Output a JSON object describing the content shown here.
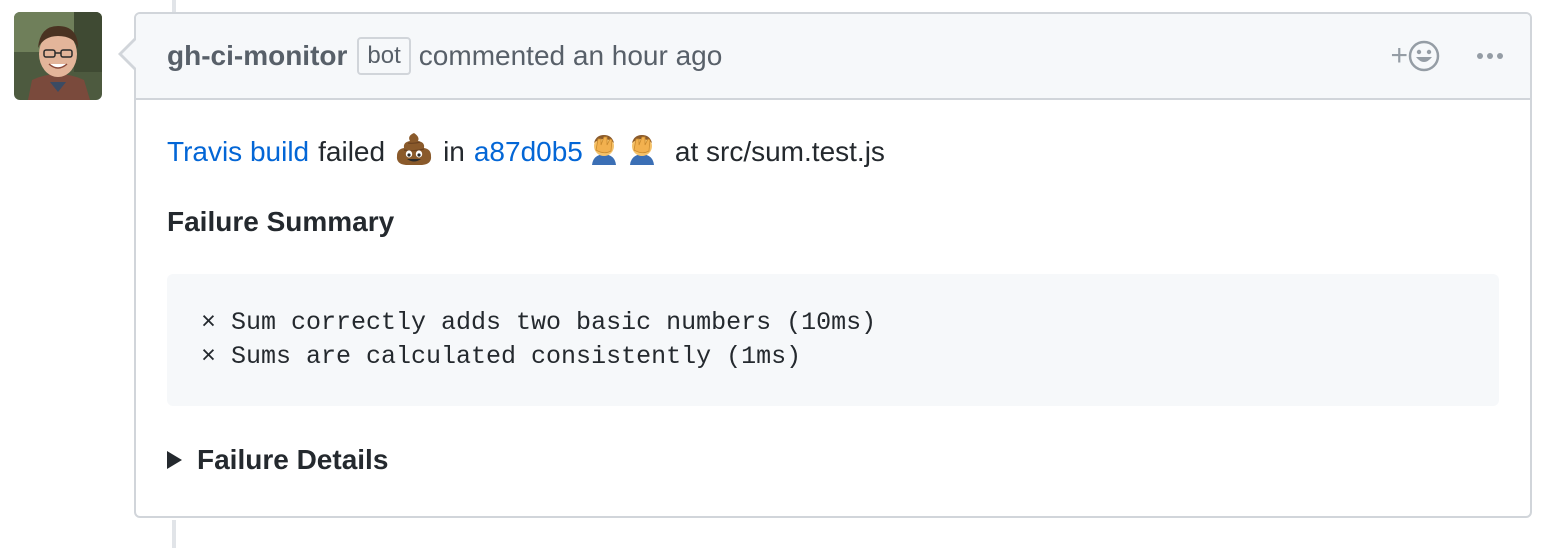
{
  "comment": {
    "author": "gh-ci-monitor",
    "author_badge": "bot",
    "action_text": "commented an hour ago",
    "reaction_plus": "+",
    "body": {
      "link_build": "Travis build",
      "failed_text": "failed",
      "in_text": "in",
      "commit_link": "a87d0b5",
      "at_text": "at src/sum.test.js",
      "summary_heading": "Failure Summary",
      "code_lines": [
        "× Sum correctly adds two basic numbers (10ms)",
        "× Sums are calculated consistently (1ms)"
      ],
      "details_label": "Failure Details"
    }
  },
  "icons": {
    "avatar": "user-avatar-photo",
    "reaction": "smiley-icon",
    "more": "kebab-horizontal-icon",
    "poop": "pile-of-poo-emoji",
    "facepalm": "facepalm-emoji",
    "details": "triangle-right-icon"
  },
  "colors": {
    "link": "#0366d6",
    "header_bg": "#f6f8fa",
    "border": "#d1d5da",
    "muted_text": "#586069",
    "code_bg": "#f6f8fa"
  }
}
